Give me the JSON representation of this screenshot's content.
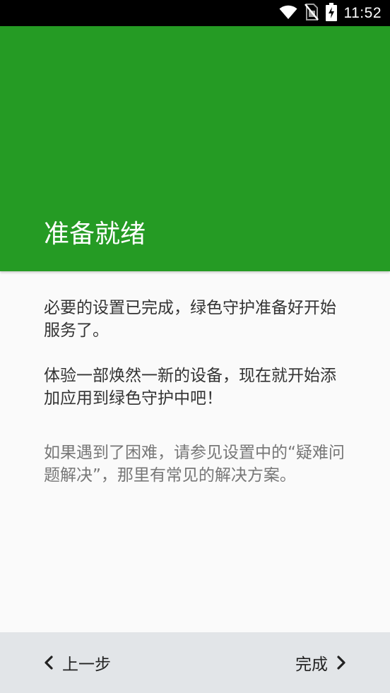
{
  "status_bar": {
    "time": "11:52",
    "icons": [
      "wifi-icon",
      "no-sim-icon",
      "battery-charging-icon"
    ]
  },
  "header": {
    "title": "准备就绪",
    "color": "#259b24"
  },
  "content": {
    "paragraph1": "必要的设置已完成，绿色守护准备好开始服务了。",
    "paragraph2": "体验一部焕然一新的设备，现在就开始添加应用到绿色守护中吧！",
    "help_text": "如果遇到了困难，请参见设置中的“疑难问题解决”，那里有常见的解决方案。"
  },
  "footer": {
    "back_label": "上一步",
    "finish_label": "完成",
    "back_icon": "chevron-left-icon",
    "finish_icon": "chevron-right-icon"
  }
}
